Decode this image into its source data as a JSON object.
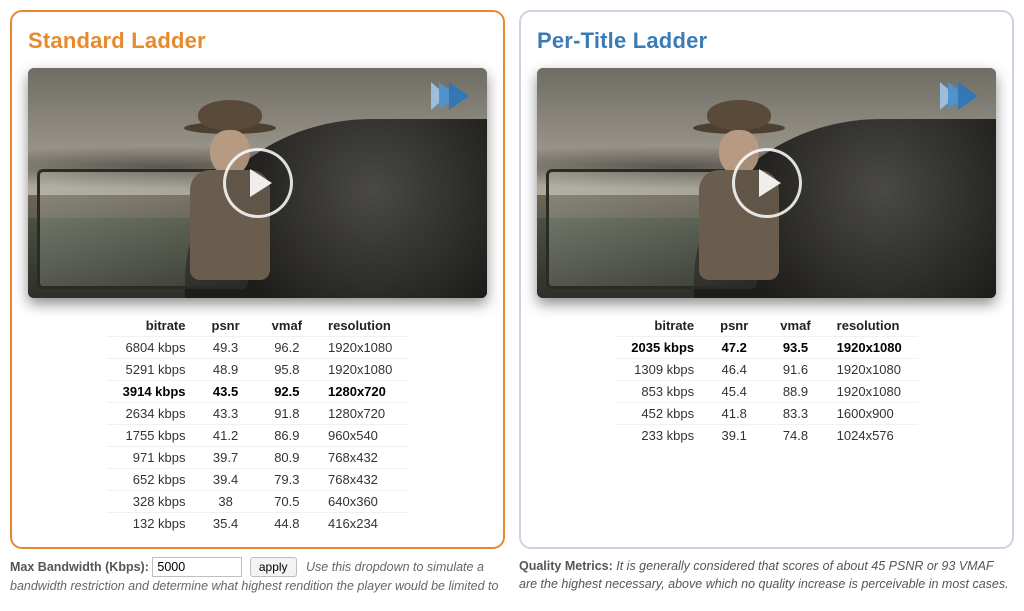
{
  "left": {
    "title": "Standard Ladder",
    "headers": {
      "bitrate": "bitrate",
      "psnr": "psnr",
      "vmaf": "vmaf",
      "res": "resolution"
    },
    "selected_index": 2,
    "rows": [
      {
        "bitrate": "6804 kbps",
        "psnr": "49.3",
        "vmaf": "96.2",
        "res": "1920x1080"
      },
      {
        "bitrate": "5291 kbps",
        "psnr": "48.9",
        "vmaf": "95.8",
        "res": "1920x1080"
      },
      {
        "bitrate": "3914 kbps",
        "psnr": "43.5",
        "vmaf": "92.5",
        "res": "1280x720"
      },
      {
        "bitrate": "2634 kbps",
        "psnr": "43.3",
        "vmaf": "91.8",
        "res": "1280x720"
      },
      {
        "bitrate": "1755 kbps",
        "psnr": "41.2",
        "vmaf": "86.9",
        "res": "960x540"
      },
      {
        "bitrate": "971 kbps",
        "psnr": "39.7",
        "vmaf": "80.9",
        "res": "768x432"
      },
      {
        "bitrate": "652 kbps",
        "psnr": "39.4",
        "vmaf": "79.3",
        "res": "768x432"
      },
      {
        "bitrate": "328 kbps",
        "psnr": "38",
        "vmaf": "70.5",
        "res": "640x360"
      },
      {
        "bitrate": "132 kbps",
        "psnr": "35.4",
        "vmaf": "44.8",
        "res": "416x234"
      }
    ]
  },
  "right": {
    "title": "Per-Title Ladder",
    "headers": {
      "bitrate": "bitrate",
      "psnr": "psnr",
      "vmaf": "vmaf",
      "res": "resolution"
    },
    "selected_index": 0,
    "rows": [
      {
        "bitrate": "2035 kbps",
        "psnr": "47.2",
        "vmaf": "93.5",
        "res": "1920x1080"
      },
      {
        "bitrate": "1309 kbps",
        "psnr": "46.4",
        "vmaf": "91.6",
        "res": "1920x1080"
      },
      {
        "bitrate": "853 kbps",
        "psnr": "45.4",
        "vmaf": "88.9",
        "res": "1920x1080"
      },
      {
        "bitrate": "452 kbps",
        "psnr": "41.8",
        "vmaf": "83.3",
        "res": "1600x900"
      },
      {
        "bitrate": "233 kbps",
        "psnr": "39.1",
        "vmaf": "74.8",
        "res": "1024x576"
      }
    ]
  },
  "controls": {
    "bw_label": "Max Bandwidth (Kbps):",
    "bw_value": "5000",
    "apply": "apply",
    "hint": "Use this dropdown to simulate a bandwidth restriction and determine what highest rendition the player would be limited to"
  },
  "metrics_note": {
    "label": "Quality Metrics:",
    "text": "It is generally considered that scores of about 45 PSNR or 93 VMAF are the highest necessary, above which no quality increase is perceivable in most cases."
  }
}
